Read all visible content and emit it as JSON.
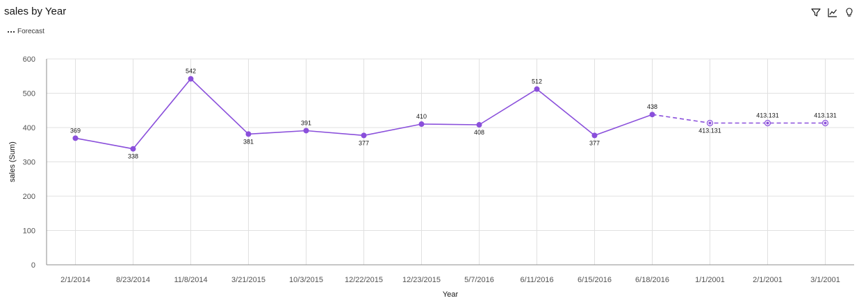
{
  "header": {
    "title": "sales by Year",
    "legend_label": "Forecast"
  },
  "toolbar": {
    "icons": [
      "filter-icon",
      "line-chart-icon",
      "lightbulb-icon"
    ]
  },
  "colors": {
    "series": "#8a4fdb",
    "grid": "#e0e0e0",
    "axis": "#8d8d8d"
  },
  "chart_data": {
    "type": "line",
    "title": "sales by Year",
    "xlabel": "Year",
    "ylabel": "sales (Sum)",
    "ylim": [
      0,
      600
    ],
    "yticks": [
      0,
      100,
      200,
      300,
      400,
      500,
      600
    ],
    "grid": true,
    "legend": "top-left",
    "categories": [
      "2/1/2014",
      "8/23/2014",
      "11/8/2014",
      "3/21/2015",
      "10/3/2015",
      "12/22/2015",
      "12/23/2015",
      "5/7/2016",
      "6/11/2016",
      "6/15/2016",
      "6/18/2016",
      "1/1/2001",
      "2/1/2001",
      "3/1/2001"
    ],
    "series": [
      {
        "name": "",
        "values": [
          369,
          338,
          542,
          381,
          391,
          377,
          410,
          408,
          512,
          377,
          438,
          null,
          null,
          null
        ],
        "labels": [
          "369",
          "338",
          "542",
          "381",
          "391",
          "377",
          "410",
          "408",
          "512",
          "377",
          "438",
          "",
          "",
          ""
        ]
      },
      {
        "name": "Forecast",
        "values": [
          null,
          null,
          null,
          null,
          null,
          null,
          null,
          null,
          null,
          null,
          438,
          413.131,
          413.131,
          413.131
        ],
        "labels": [
          "",
          "",
          "",
          "",
          "",
          "",
          "",
          "",
          "",
          "",
          "",
          "413.131",
          "413.131",
          "413.131"
        ]
      }
    ],
    "label_below": [
      false,
      true,
      false,
      true,
      false,
      true,
      false,
      true,
      false,
      true,
      false,
      true,
      false,
      false
    ]
  }
}
